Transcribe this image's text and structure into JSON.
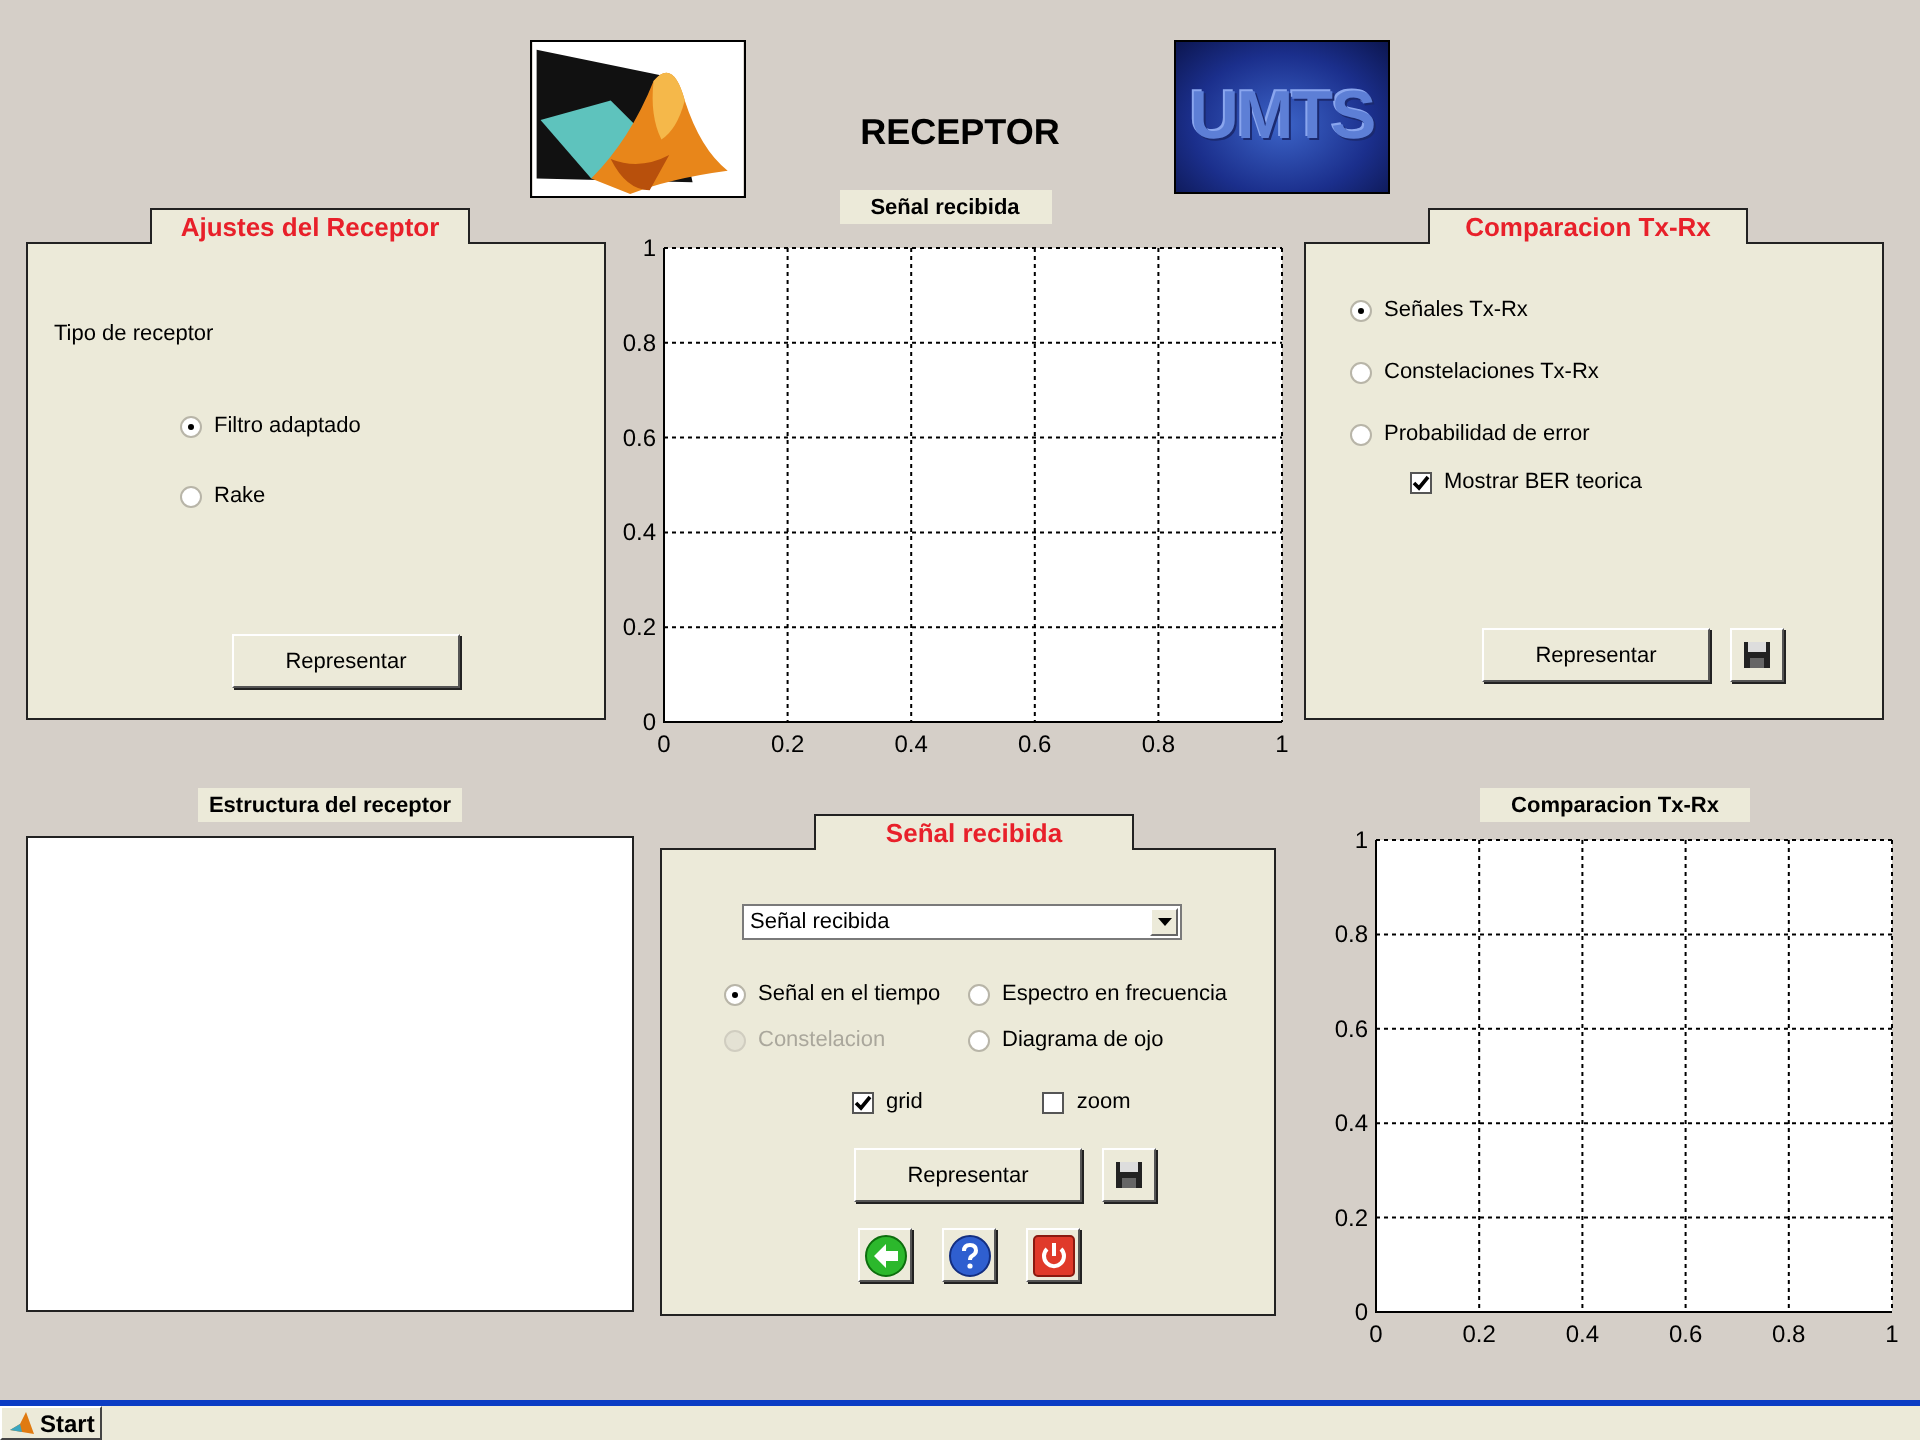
{
  "header": {
    "title": "RECEPTOR",
    "logo_text": "UMTS"
  },
  "receiver_settings": {
    "title": "Ajustes del Receptor",
    "label": "Tipo de receptor",
    "options": [
      {
        "label": "Filtro adaptado",
        "selected": true
      },
      {
        "label": "Rake",
        "selected": false
      }
    ],
    "button": "Representar"
  },
  "received_signal_plot": {
    "title": "Señal recibida",
    "chart_data": {
      "type": "line",
      "grid": true,
      "xlim": [
        0,
        1
      ],
      "ylim": [
        0,
        1
      ],
      "xticks": [
        0,
        0.2,
        0.4,
        0.6,
        0.8,
        1
      ],
      "yticks": [
        0,
        0.2,
        0.4,
        0.6,
        0.8,
        1
      ]
    }
  },
  "comparison_panel": {
    "title": "Comparacion Tx-Rx",
    "options": [
      {
        "kind": "radio",
        "label": "Señales Tx-Rx",
        "selected": true
      },
      {
        "kind": "radio",
        "label": "Constelaciones Tx-Rx",
        "selected": false
      },
      {
        "kind": "radio",
        "label": "Probabilidad de error",
        "selected": false
      },
      {
        "kind": "checkbox",
        "label": "Mostrar BER teorica",
        "checked": true
      }
    ],
    "button": "Representar"
  },
  "structure_panel": {
    "title": "Estructura del receptor"
  },
  "signal_panel": {
    "title": "Señal recibida",
    "dropdown": "Señal recibida",
    "options": [
      {
        "label": "Señal en el tiempo",
        "selected": true,
        "disabled": false
      },
      {
        "label": "Espectro en frecuencia",
        "selected": false,
        "disabled": false
      },
      {
        "label": "Constelacion",
        "selected": false,
        "disabled": true
      },
      {
        "label": "Diagrama de ojo",
        "selected": false,
        "disabled": false
      }
    ],
    "checkboxes": [
      {
        "label": "grid",
        "checked": true
      },
      {
        "label": "zoom",
        "checked": false
      }
    ],
    "button": "Representar"
  },
  "comparison_plot": {
    "title": "Comparacion Tx-Rx",
    "chart_data": {
      "type": "line",
      "grid": true,
      "xlim": [
        0,
        1
      ],
      "ylim": [
        0,
        1
      ],
      "xticks": [
        0,
        0.2,
        0.4,
        0.6,
        0.8,
        1
      ],
      "yticks": [
        0,
        0.2,
        0.4,
        0.6,
        0.8,
        1
      ]
    }
  },
  "taskbar": {
    "start": "Start"
  }
}
